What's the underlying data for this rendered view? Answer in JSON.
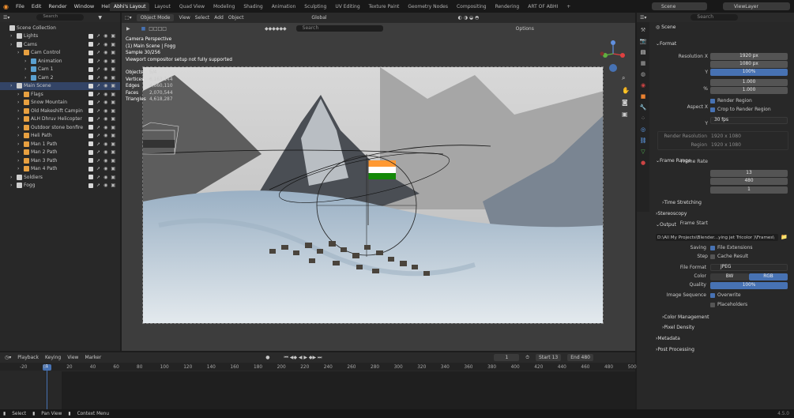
{
  "menu": [
    "File",
    "Edit",
    "Render",
    "Window",
    "Help"
  ],
  "tabs": [
    "Abhi's Layout",
    "Layout",
    "Quad View",
    "Modeling",
    "Shading",
    "Animation",
    "Sculpting",
    "UV Editing",
    "Texture Paint",
    "Geometry Nodes",
    "Compositing",
    "Rendering",
    "ART OF ABHI"
  ],
  "scene_name": "Scene",
  "view_layer": "ViewLayer",
  "outliner": {
    "search_placeholder": "Search",
    "rows": [
      {
        "label": "Scene Collection",
        "indent": 0
      },
      {
        "label": "Lights",
        "indent": 1
      },
      {
        "label": "Cams",
        "indent": 1
      },
      {
        "label": "Cam Control",
        "indent": 2
      },
      {
        "label": "Animation",
        "indent": 3
      },
      {
        "label": "Cam 1",
        "indent": 3
      },
      {
        "label": "Cam 2",
        "indent": 3
      },
      {
        "label": "Main Scene",
        "indent": 1
      },
      {
        "label": "Flags",
        "indent": 2
      },
      {
        "label": "Snow Mountain",
        "indent": 2
      },
      {
        "label": "Old Makeshift Campin",
        "indent": 2
      },
      {
        "label": "ALH Dhruv Helicopter",
        "indent": 2
      },
      {
        "label": "Outdoor stone bonfire",
        "indent": 2
      },
      {
        "label": "Heli Path",
        "indent": 2
      },
      {
        "label": "Man 1 Path",
        "indent": 2
      },
      {
        "label": "Man 2 Path",
        "indent": 2
      },
      {
        "label": "Man 3 Path",
        "indent": 2
      },
      {
        "label": "Man 4 Path",
        "indent": 2
      },
      {
        "label": "Soldiers",
        "indent": 1
      },
      {
        "label": "Fogg",
        "indent": 1
      }
    ]
  },
  "viewport": {
    "mode": "Object Mode",
    "menus": [
      "View",
      "Select",
      "Add",
      "Object"
    ],
    "transform": "Global",
    "search": "Search",
    "options": "Options",
    "overlay": [
      "Camera Perspective",
      "(1) Main Scene | Fogg",
      "Sample 30/256",
      "Viewport compositor setup not fully supported"
    ],
    "stats": [
      [
        "Objects",
        "5/4"
      ],
      [
        "Vertices",
        "6,163,144"
      ],
      [
        "Edges",
        "4,660,110"
      ],
      [
        "Faces",
        "2,070,544"
      ],
      [
        "Triangles",
        "4,618,287"
      ]
    ]
  },
  "properties": {
    "search": "Search",
    "scene": "Scene",
    "format": {
      "title": "Format",
      "res_x_label": "Resolution X",
      "res_x": "1920 px",
      "y_label": "Y",
      "res_y": "1080 px",
      "pct_label": "%",
      "pct": "100%",
      "aspect_label": "Aspect X",
      "aspect_x": "1.000",
      "aspect_y": "1.000",
      "render_region": "Render Region",
      "crop": "Crop to Render Region",
      "frame_rate_label": "Frame Rate",
      "frame_rate": "30 fps",
      "render_res_label": "Render Resolution",
      "render_res": "1920 x 1080",
      "region_label": "Region",
      "region": "1920 x 1080"
    },
    "frame_range": {
      "title": "Frame Range",
      "start_label": "Frame Start",
      "start": "13",
      "end_label": "End",
      "end": "480",
      "step_label": "Step",
      "step": "1",
      "time_stretching": "Time Stretching"
    },
    "stereoscopy": "Stereoscopy",
    "output": {
      "title": "Output",
      "path": "D:\\All My Projects\\Blender...ying jet Tricolor )\\Frames\\",
      "saving_label": "Saving",
      "file_ext": "File Extensions",
      "cache": "Cache Result",
      "format_label": "File Format",
      "format": "JPEG",
      "color_label": "Color",
      "bw": "BW",
      "rgb": "RGB",
      "quality_label": "Quality",
      "quality": "100%",
      "seq_label": "Image Sequence",
      "overwrite": "Overwrite",
      "placeholders": "Placeholders",
      "color_mgmt": "Color Management",
      "pixel_density": "Pixel Density"
    },
    "metadata": "Metadata",
    "post": "Post Processing"
  },
  "timeline": {
    "menus": [
      "Playback",
      "Keying",
      "View",
      "Marker"
    ],
    "current": "1",
    "start_label": "Start",
    "start": "13",
    "end_label": "End",
    "end": "480",
    "ticks": [
      "-20",
      "0",
      "20",
      "40",
      "60",
      "80",
      "100",
      "120",
      "140",
      "160",
      "180",
      "200",
      "220",
      "240",
      "260",
      "280",
      "300",
      "320",
      "340",
      "360",
      "380",
      "400",
      "420",
      "440",
      "460",
      "480",
      "500"
    ],
    "playhead": "1"
  },
  "status": {
    "select": "Select",
    "pan": "Pan View",
    "context": "Context Menu",
    "version": "4.5.0"
  },
  "colors": {
    "accent": "#4772b3",
    "bg": "#1d1d1d",
    "panel": "#282828"
  }
}
